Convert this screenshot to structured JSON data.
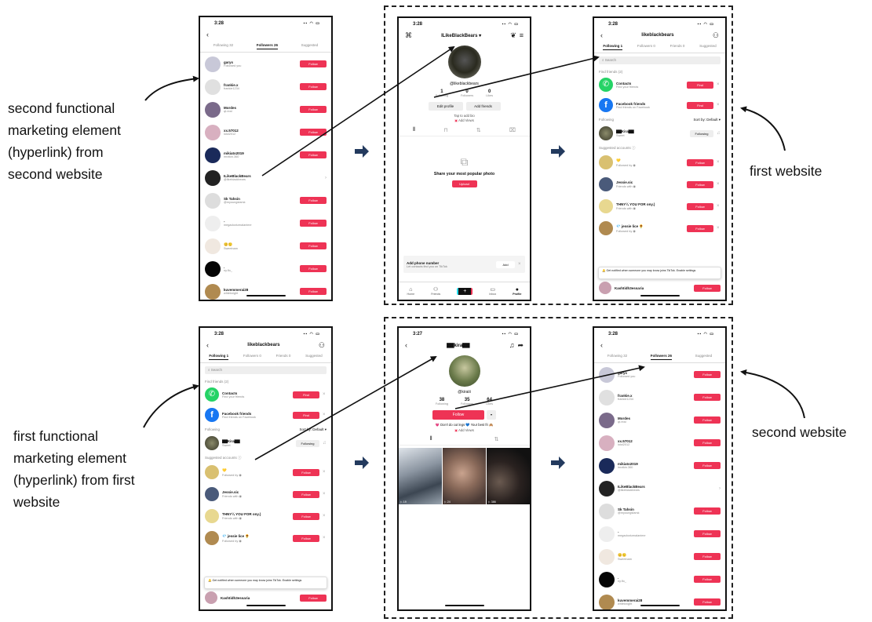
{
  "labels": {
    "top_left": [
      "second functional",
      "marketing element",
      "(hyperlink) from",
      "second website"
    ],
    "top_right": "first website",
    "bottom_left": [
      "first functional",
      "marketing element",
      "(hyperlink) from first",
      "website"
    ],
    "bottom_right": "second website"
  },
  "following_screen": {
    "time": "3:28",
    "header_title": "likeblackbears",
    "tabs": [
      "Following 1",
      "Followers 0",
      "Friends 0",
      "Suggested"
    ],
    "search_placeholder": "Search",
    "find_friends_label": "Find friends (2)",
    "contacts": {
      "name": "Contacts",
      "sub": "Find your friends",
      "btn": "Find"
    },
    "facebook": {
      "name": "Facebook friends",
      "sub": "Find friends on Facebook",
      "btn": "Find"
    },
    "following_label": "Following",
    "sort_label": "Sort by: Default ▾",
    "following_user": {
      "name": "▇▇Kira▇▇",
      "sub": "Sweet",
      "btn": "Following"
    },
    "suggested_label": "Suggested accounts ⓘ",
    "suggested": [
      {
        "name": "💛",
        "sub": "Followed by ◉",
        "btn": "Follow"
      },
      {
        "name": "Jessie.sic",
        "sub": "Friends with ◉",
        "btn": "Follow"
      },
      {
        "name": "THNY¼ YOU FOR ony.)",
        "sub": "Friends with ◉",
        "btn": "Follow"
      },
      {
        "name": "💎 jessie lice 🌻",
        "sub": "Followed by ◉",
        "btn": "Follow"
      }
    ],
    "banner": "Get notified when someone you may know joins TikTok. Enable settings",
    "last_user": "Kashtidh3essaria",
    "last_btn": "Follow"
  },
  "followers_screen": {
    "time": "3:28",
    "tabs": [
      "Following 32",
      "Followers 26",
      "Suggested"
    ],
    "rows": [
      {
        "name": "garys",
        "sub": "Followed you",
        "btn": "Follow"
      },
      {
        "name": "frankie.x",
        "sub": "frankie1234",
        "btn": "Follow"
      },
      {
        "name": "Mordes",
        "sub": "qt.real",
        "btn": "Follow"
      },
      {
        "name": "xx.57012",
        "sub": "lolol2012",
        "btn": "Follow"
      },
      {
        "name": "mikiato2019",
        "sub": "lrnxtkin.360",
        "btn": "Follow"
      },
      {
        "name": "ILikeBlackBears",
        "sub": "@likeblackbears",
        "btn": ""
      },
      {
        "name": "Sk Tahsin",
        "sub": "@myoungstarsk",
        "btn": "Follow"
      },
      {
        "name": "-",
        "sub": "megadocturnalanime",
        "btn": "Follow"
      },
      {
        "name": "😊🙂",
        "sub": "Sweetnam",
        "btn": "Follow"
      },
      {
        "name": ".",
        "sub": "ny.flo_",
        "btn": "Follow"
      },
      {
        "name": "kuvemmerai28",
        "sub": "whteknight",
        "btn": "Follow"
      }
    ]
  },
  "own_profile": {
    "time": "3:28",
    "title": "ILikeBlackBears ▾",
    "handle": "@likeblackbears",
    "stats": [
      {
        "n": "1",
        "l": "Following"
      },
      {
        "n": "0",
        "l": "Followers"
      },
      {
        "n": "0",
        "l": "Likes"
      }
    ],
    "edit_btn": "Edit profile",
    "add_btn": "Add friends",
    "bio": "Tap to add bio",
    "add_views": "Add Views",
    "empty_title": "Share your most popular photo",
    "upload_btn": "Upload",
    "phone_title": "Add phone number",
    "phone_sub": "Let contacts find you on TikTok",
    "phone_btn": "Add",
    "nav": [
      "Home",
      "Friends",
      "",
      "Inbox",
      "Profile"
    ]
  },
  "other_profile": {
    "time": "3:27",
    "title": "▇▇kira▇▇",
    "handle": "@kiraiii",
    "stats": [
      {
        "n": "38",
        "l": "Following"
      },
      {
        "n": "35",
        "l": "Followers"
      },
      {
        "n": "64",
        "l": "Likes"
      }
    ],
    "follow_btn": "Follow",
    "bio": "💗 Don't do cut legs 💙 Your best fri 🙈",
    "add_views": "Add Views",
    "views": [
      "▷ 19",
      "▷ 24",
      "▷ 386"
    ]
  },
  "colors": {
    "accent": "#ee3355",
    "arrow": "#233a5e"
  }
}
